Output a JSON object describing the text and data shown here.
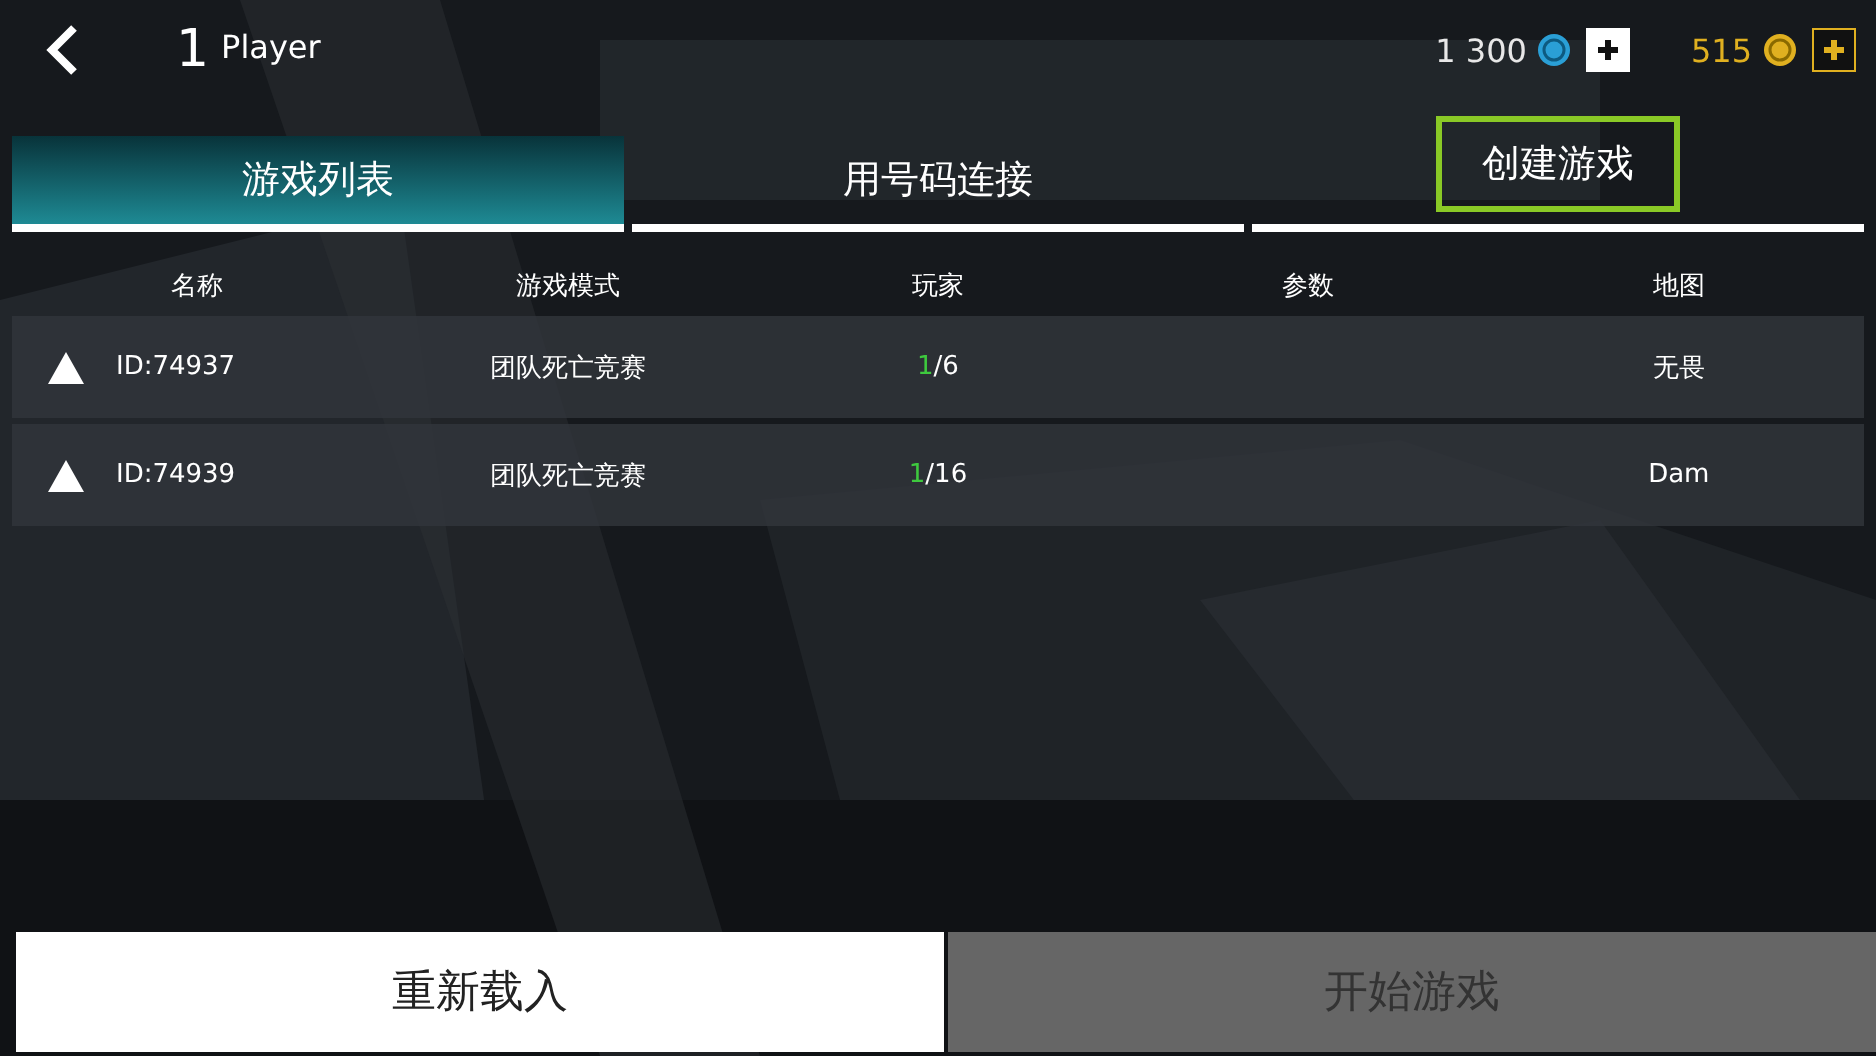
{
  "header": {
    "player_number": "1",
    "player_label": "Player",
    "credits": "1 300",
    "gold": "515"
  },
  "tabs": [
    {
      "label": "游戏列表",
      "selected": true,
      "highlighted": false
    },
    {
      "label": "用号码连接",
      "selected": false,
      "highlighted": false
    },
    {
      "label": "创建游戏",
      "selected": false,
      "highlighted": true
    }
  ],
  "table": {
    "columns": [
      "名称",
      "游戏模式",
      "玩家",
      "参数",
      "地图"
    ],
    "rows": [
      {
        "id": "ID:74937",
        "mode": "团队死亡竞赛",
        "players_online": "1",
        "players_max": "/6",
        "map": "无畏"
      },
      {
        "id": "ID:74939",
        "mode": "团队死亡竞赛",
        "players_online": "1",
        "players_max": "/16",
        "map": "Dam"
      }
    ]
  },
  "buttons": [
    {
      "label": "重新载入",
      "disabled": false
    },
    {
      "label": "开始游戏",
      "disabled": true
    }
  ]
}
